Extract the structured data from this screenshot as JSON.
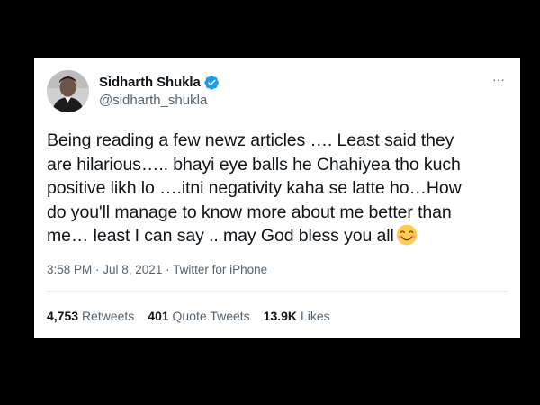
{
  "tweet": {
    "author": {
      "display_name": "Sidharth Shukla",
      "handle": "@sidharth_shukla",
      "verified_icon": "verified-badge-icon",
      "avatar": "avatar-photo"
    },
    "more_icon": "more-options-icon",
    "more_glyph": "···",
    "text_lines": [
      "Being reading a few newz articles …. Least said they",
      "are hilarious….. bhayi eye balls he Chahiyea tho kuch",
      "positive likh lo ….itni negativity kaha se latte ho…How",
      "do you'll manage to know more about me better than",
      "me… least I can say .. may God bless you all"
    ],
    "emoji": "smiling-face-with-smiling-eyes-emoji",
    "meta": "3:58 PM · Jul 8, 2021 · Twitter for iPhone",
    "stats": {
      "retweets_count": "4,753",
      "retweets_label": "Retweets",
      "quotes_count": "401",
      "quotes_label": "Quote Tweets",
      "likes_count": "13.9K",
      "likes_label": "Likes"
    }
  },
  "colors": {
    "background": "#000000",
    "card": "#ffffff",
    "text_primary": "#0f1419",
    "text_secondary": "#536471",
    "verified_blue": "#1d9bf0",
    "emoji_yellow": "#ffcc4d"
  }
}
